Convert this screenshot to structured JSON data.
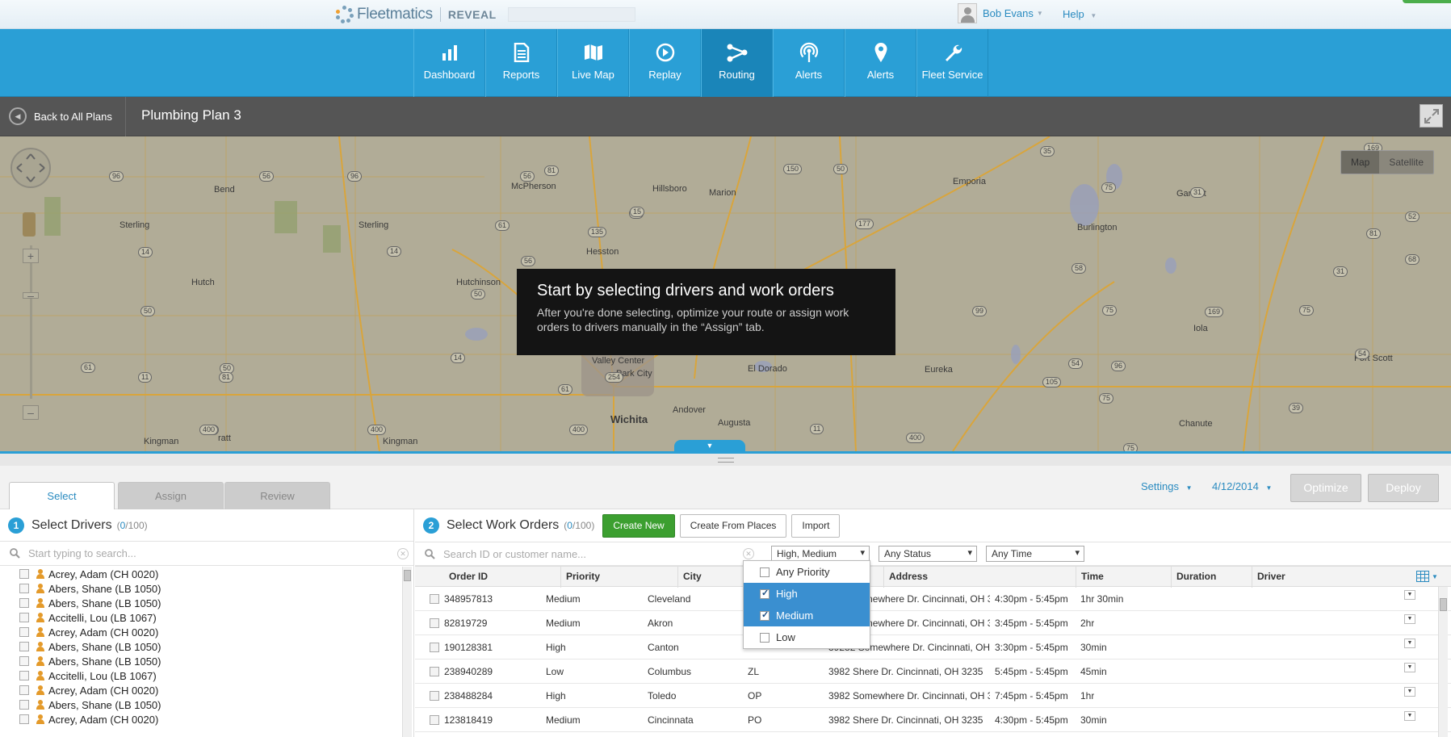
{
  "header": {
    "logo_name": "Fleetmatics",
    "logo_product": "REVEAL",
    "user_name": "Bob Evans",
    "help_label": "Help"
  },
  "nav": {
    "items": [
      {
        "label": "Dashboard",
        "icon": "bar-chart-icon"
      },
      {
        "label": "Reports",
        "icon": "document-icon"
      },
      {
        "label": "Live Map",
        "icon": "map-icon"
      },
      {
        "label": "Replay",
        "icon": "play-icon"
      },
      {
        "label": "Routing",
        "icon": "route-icon",
        "active": true
      },
      {
        "label": "Alerts",
        "icon": "broadcast-icon"
      },
      {
        "label": "Alerts",
        "icon": "map-pin-icon"
      },
      {
        "label": "Fleet Service",
        "icon": "wrench-icon"
      }
    ]
  },
  "plan": {
    "back_label": "Back to All Plans",
    "title": "Plumbing Plan 3"
  },
  "map": {
    "type_options": [
      "Map",
      "Satellite"
    ],
    "overlay_title": "Start by selecting drivers and work orders",
    "overlay_text": "After you're done selecting, optimize your route or assign work orders to drivers manually in the “Assign” tab.",
    "places": [
      {
        "name": "Emporia"
      },
      {
        "name": "McPherson"
      },
      {
        "name": "Hillsboro"
      },
      {
        "name": "Marion"
      },
      {
        "name": "Sterling"
      },
      {
        "name": "Sterling"
      },
      {
        "name": "Hesston"
      },
      {
        "name": "Hutchinson"
      },
      {
        "name": "Hutch"
      },
      {
        "name": "Valley Center"
      },
      {
        "name": "Park City"
      },
      {
        "name": "El Dorado"
      },
      {
        "name": "Wichita"
      },
      {
        "name": "Andover"
      },
      {
        "name": "Augusta"
      },
      {
        "name": "Kingman"
      },
      {
        "name": "Kingman"
      },
      {
        "name": "Bend"
      },
      {
        "name": "Eureka"
      },
      {
        "name": "Burlington"
      },
      {
        "name": "Garnett"
      },
      {
        "name": "Iola"
      },
      {
        "name": "Chanute"
      },
      {
        "name": "Fort Scott"
      },
      {
        "name": "ratt"
      }
    ],
    "shields": [
      "96",
      "56",
      "96",
      "56",
      "81",
      "15",
      "150",
      "50",
      "35",
      "75",
      "31",
      "169",
      "81",
      "61",
      "135",
      "15",
      "177",
      "52",
      "14",
      "14",
      "50",
      "50",
      "56",
      "58",
      "31",
      "68",
      "61",
      "50",
      "99",
      "75",
      "169",
      "3",
      "75",
      "14",
      "254",
      "96",
      "54",
      "54",
      "61",
      "11",
      "81",
      "400",
      "105",
      "75",
      "39",
      "400",
      "11",
      "400",
      "400",
      "400",
      "75"
    ]
  },
  "tabs": {
    "select": "Select",
    "assign": "Assign",
    "review": "Review",
    "settings": "Settings",
    "date": "4/12/2014",
    "optimize": "Optimize",
    "deploy": "Deploy"
  },
  "drivers_panel": {
    "step": "1",
    "title": "Select Drivers",
    "count_selected": "0",
    "count_total": "/100",
    "search_placeholder": "Start typing to search...",
    "drivers": [
      "Acrey, Adam (CH 0020)",
      "Abers, Shane (LB 1050)",
      "Abers, Shane (LB 1050)",
      "Accitelli, Lou (LB 1067)",
      "Acrey, Adam (CH 0020)",
      "Abers, Shane (LB 1050)",
      "Abers, Shane (LB 1050)",
      "Accitelli, Lou (LB 1067)",
      "Acrey, Adam (CH 0020)",
      "Abers, Shane (LB 1050)",
      "Acrey, Adam (CH 0020)"
    ]
  },
  "orders_panel": {
    "step": "2",
    "title": "Select Work Orders",
    "count_selected": "0",
    "count_total": "/100",
    "create_new": "Create New",
    "create_from_places": "Create From Places",
    "import": "Import",
    "search_placeholder": "Search ID or customer name...",
    "filter_priority": "High, Medium",
    "filter_status": "Any Status",
    "filter_time": "Any Time",
    "columns": [
      "Order ID",
      "Priority",
      "City",
      "",
      "Address",
      "Time",
      "Duration",
      "Driver"
    ],
    "rows": [
      [
        "348957813",
        "Medium",
        "Cleveland",
        "",
        "3982 Somewhere Dr. Cincinnati, OH 3...",
        "4:30pm - 5:45pm",
        "1hr 30min",
        ""
      ],
      [
        "82819729",
        "Medium",
        "Akron",
        "",
        "3982 Somewhere Dr. Cincinnati, OH 3...",
        "3:45pm - 5:45pm",
        "2hr",
        ""
      ],
      [
        "190128381",
        "High",
        "Canton",
        "",
        "39282 Somewhere Dr. Cincinnati, OH ...",
        "3:30pm - 5:45pm",
        "30min",
        ""
      ],
      [
        "238940289",
        "Low",
        "Columbus",
        "ZL",
        "3982 Shere Dr. Cincinnati, OH 3235",
        "5:45pm - 5:45pm",
        "45min",
        ""
      ],
      [
        "238488284",
        "High",
        "Toledo",
        "OP",
        "3982 Somewhere Dr. Cincinnati, OH 3...",
        "7:45pm - 5:45pm",
        "1hr",
        ""
      ],
      [
        "123818419",
        "Medium",
        "Cincinnata",
        "PO",
        "3982 Shere Dr. Cincinnati, OH 3235",
        "4:30pm - 5:45pm",
        "30min",
        ""
      ]
    ]
  },
  "priority_dropdown": {
    "options": [
      {
        "label": "Any Priority",
        "checked": false
      },
      {
        "label": "High",
        "checked": true
      },
      {
        "label": "Medium",
        "checked": true
      },
      {
        "label": "Low",
        "checked": false
      }
    ]
  }
}
